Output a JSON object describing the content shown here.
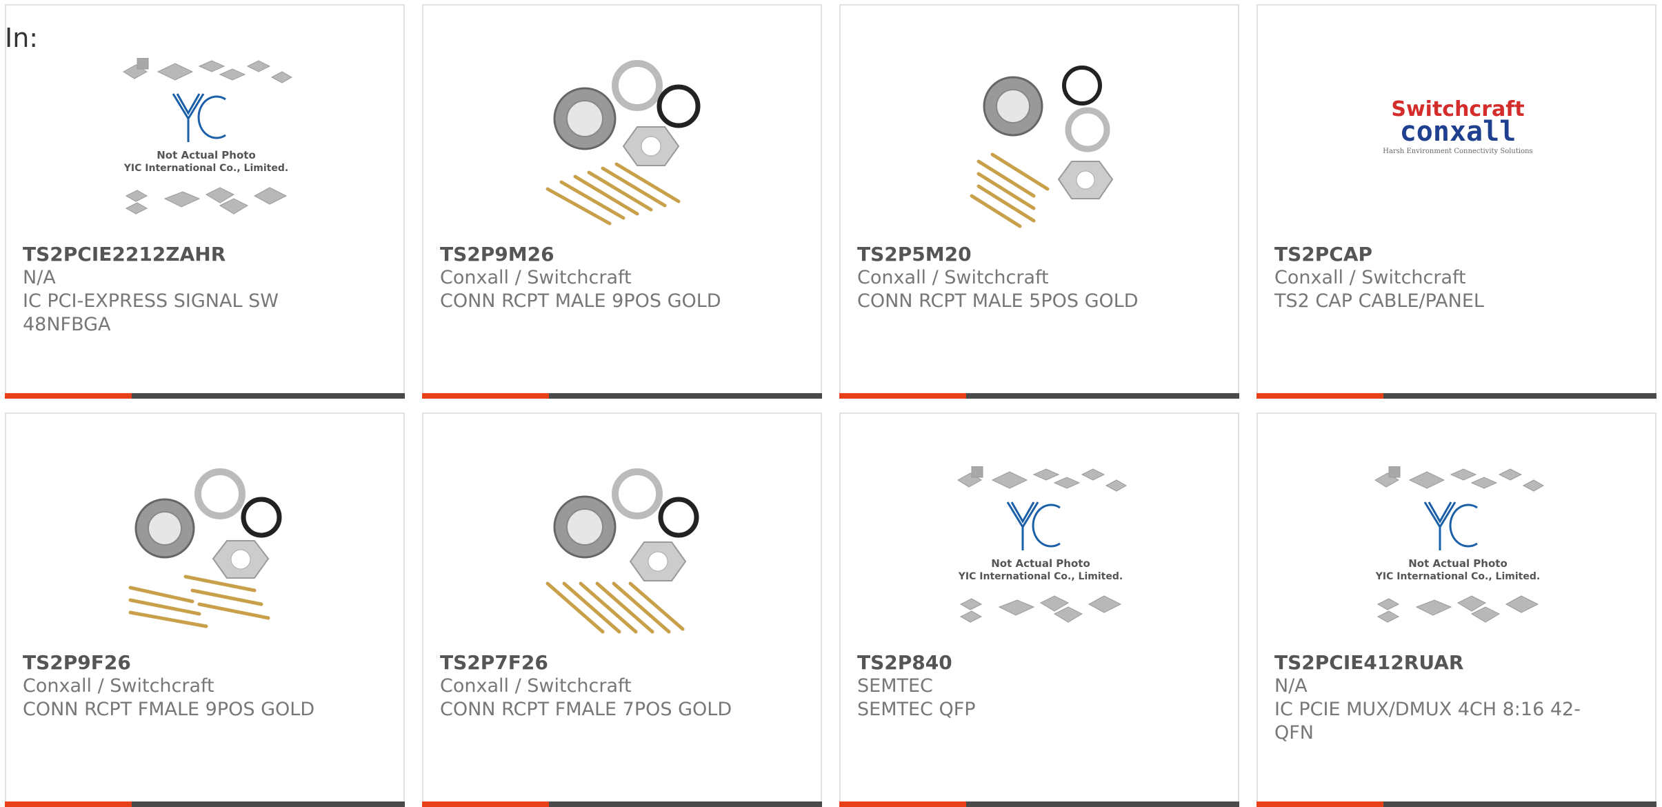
{
  "header": {
    "label": "In:"
  },
  "products": [
    {
      "part_number": "TS2PCIE2212ZAHR",
      "manufacturer": "N/A",
      "description": "IC PCI-EXPRESS SIGNAL SW 48NFBGA",
      "image": "placeholder-yic-icon",
      "image_caption_1": "Not Actual Photo",
      "image_caption_2": "YIC International Co., Limited.",
      "image_logo_text": "YIC"
    },
    {
      "part_number": "TS2P9M26",
      "manufacturer": "Conxall / Switchcraft",
      "description": "CONN RCPT MALE 9POS GOLD",
      "image": "connector-kit-photo"
    },
    {
      "part_number": "TS2P5M20",
      "manufacturer": "Conxall / Switchcraft",
      "description": "CONN RCPT MALE 5POS GOLD",
      "image": "connector-kit-photo"
    },
    {
      "part_number": "TS2PCAP",
      "manufacturer": "Conxall / Switchcraft",
      "description": "TS2 CAP CABLE/PANEL",
      "image": "brand-logo",
      "logo_line_1": "Switchcraft",
      "logo_line_2": "conxall",
      "logo_tagline": "Harsh Environment Connectivity Solutions"
    },
    {
      "part_number": "TS2P9F26",
      "manufacturer": "Conxall / Switchcraft",
      "description": "CONN RCPT FMALE 9POS GOLD",
      "image": "connector-kit-photo"
    },
    {
      "part_number": "TS2P7F26",
      "manufacturer": "Conxall / Switchcraft",
      "description": "CONN RCPT FMALE 7POS GOLD",
      "image": "connector-kit-photo"
    },
    {
      "part_number": "TS2P840",
      "manufacturer": "SEMTEC",
      "description": "SEMTEC QFP",
      "image": "placeholder-yic-icon",
      "image_caption_1": "Not Actual Photo",
      "image_caption_2": "YIC International Co., Limited.",
      "image_logo_text": "YIC"
    },
    {
      "part_number": "TS2PCIE412RUAR",
      "manufacturer": "N/A",
      "description": "IC PCIE MUX/DMUX 4CH 8:16 42-QFN",
      "image": "placeholder-yic-icon",
      "image_caption_1": "Not Actual Photo",
      "image_caption_2": "YIC International Co., Limited.",
      "image_logo_text": "YIC"
    }
  ],
  "colors": {
    "accent": "#e8411a",
    "bar": "#4a4a4a",
    "border": "#e2e2e2",
    "text": "#777777",
    "yic_blue": "#1a5fa8",
    "switchcraft_red": "#d42b2b",
    "conxall_blue": "#1f3f8f"
  }
}
